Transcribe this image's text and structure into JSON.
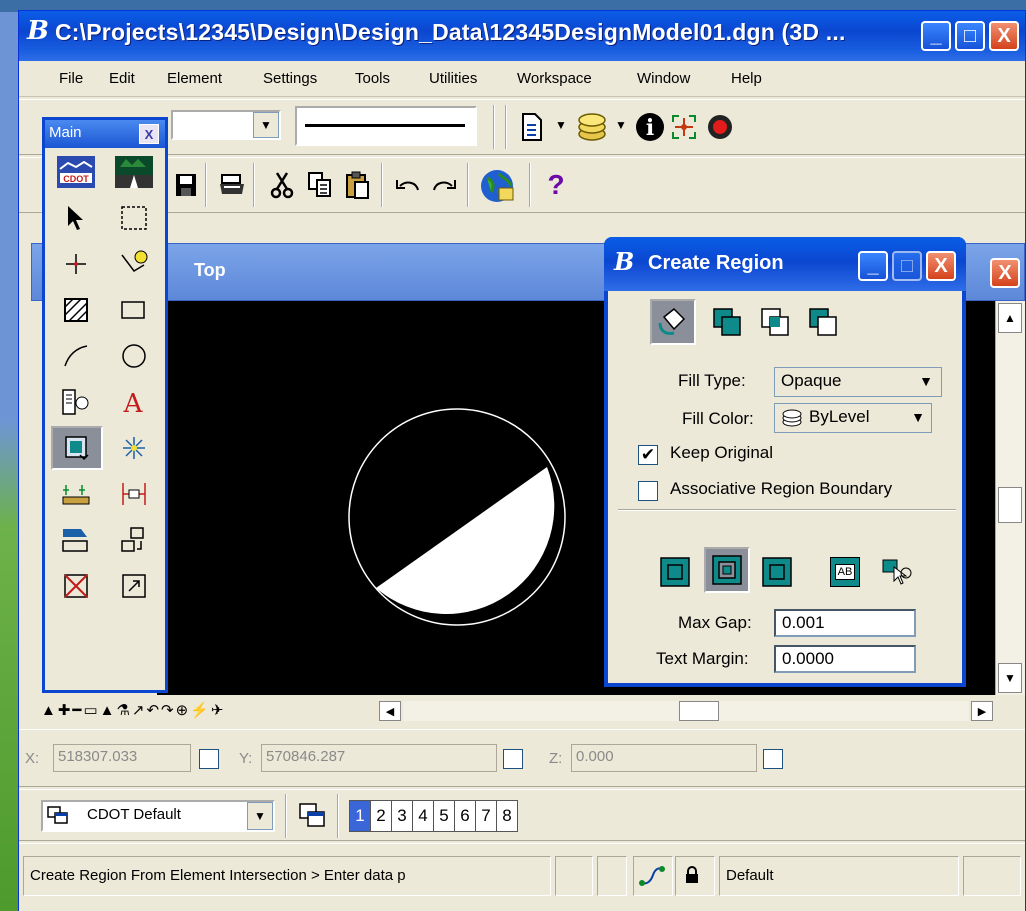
{
  "window": {
    "title": "C:\\Projects\\12345\\Design\\Design_Data\\12345DesignModel01.dgn (3D ...",
    "min_glyph": "_",
    "max_glyph": "□",
    "close_glyph": "X"
  },
  "menu": [
    {
      "label": "File"
    },
    {
      "label": "Edit"
    },
    {
      "label": "Element"
    },
    {
      "label": "Settings"
    },
    {
      "label": "Tools"
    },
    {
      "label": "Utilities"
    },
    {
      "label": "Workspace"
    },
    {
      "label": "Window"
    },
    {
      "label": "Help"
    }
  ],
  "toolbar": {
    "help_glyph": "?"
  },
  "palette": {
    "title": "Main",
    "close_glyph": "X"
  },
  "view": {
    "title": "Top"
  },
  "dialog": {
    "title": "Create Region",
    "fill_type_label": "Fill Type:",
    "fill_type_value": "Opaque",
    "fill_color_label": "Fill Color:",
    "fill_color_value": "ByLevel",
    "keep_original_label": "Keep Original",
    "keep_original_checked": true,
    "associative_label": "Associative Region Boundary",
    "associative_checked": false,
    "max_gap_label": "Max Gap:",
    "max_gap_value": "0.001",
    "text_margin_label": "Text Margin:",
    "text_margin_value": "0.0000",
    "ab_glyph": "AB"
  },
  "coords": {
    "x_label": "X:",
    "x_value": "518307.033",
    "y_label": "Y:",
    "y_value": "570846.287",
    "z_label": "Z:",
    "z_value": "0.000"
  },
  "view_controls": {
    "workspace_value": "CDOT Default",
    "view_numbers": [
      "1",
      "2",
      "3",
      "4",
      "5",
      "6",
      "7",
      "8"
    ],
    "selected_view": "1"
  },
  "status": {
    "prompt": "Create Region From Element Intersection > Enter data p",
    "level": "Default"
  },
  "colors": {
    "titlebar": "#0b46d0",
    "teal_tool": "#0f8a8a"
  }
}
